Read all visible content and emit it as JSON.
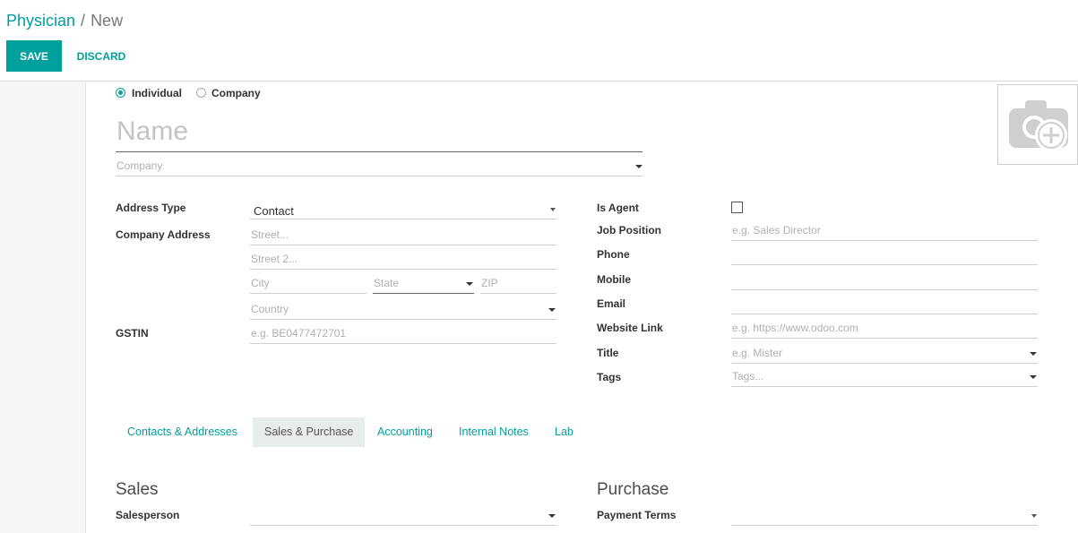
{
  "breadcrumb": {
    "parent": "Physician",
    "separator": "/",
    "current": "New"
  },
  "toolbar": {
    "save_label": "SAVE",
    "discard_label": "DISCARD"
  },
  "partner_type": {
    "individual_label": "Individual",
    "company_label": "Company",
    "selected": "Individual"
  },
  "name": {
    "placeholder": "Name",
    "value": ""
  },
  "company": {
    "placeholder": "Company"
  },
  "left_fields": {
    "address_type_label": "Address Type",
    "address_type_value": "Contact",
    "company_address_label": "Company Address",
    "street_placeholder": "Street...",
    "street2_placeholder": "Street 2...",
    "city_placeholder": "City",
    "state_placeholder": "State",
    "zip_placeholder": "ZIP",
    "country_placeholder": "Country",
    "gstin_label": "GSTIN",
    "gstin_placeholder": "e.g. BE0477472701"
  },
  "right_fields": {
    "is_agent_label": "Is Agent",
    "job_position_label": "Job Position",
    "job_position_placeholder": "e.g. Sales Director",
    "phone_label": "Phone",
    "mobile_label": "Mobile",
    "email_label": "Email",
    "website_label": "Website Link",
    "website_placeholder": "e.g. https://www.odoo.com",
    "title_label": "Title",
    "title_placeholder": "e.g. Mister",
    "tags_label": "Tags",
    "tags_placeholder": "Tags..."
  },
  "tabs": [
    {
      "label": "Contacts & Addresses",
      "active": false
    },
    {
      "label": "Sales & Purchase",
      "active": true
    },
    {
      "label": "Accounting",
      "active": false
    },
    {
      "label": "Internal Notes",
      "active": false
    },
    {
      "label": "Lab",
      "active": false
    }
  ],
  "sales": {
    "title": "Sales",
    "salesperson_label": "Salesperson"
  },
  "purchase": {
    "title": "Purchase",
    "payment_terms_label": "Payment Terms"
  },
  "icons": {
    "avatar_placeholder": "camera-plus-icon"
  },
  "colors": {
    "accent": "#00a09d"
  }
}
